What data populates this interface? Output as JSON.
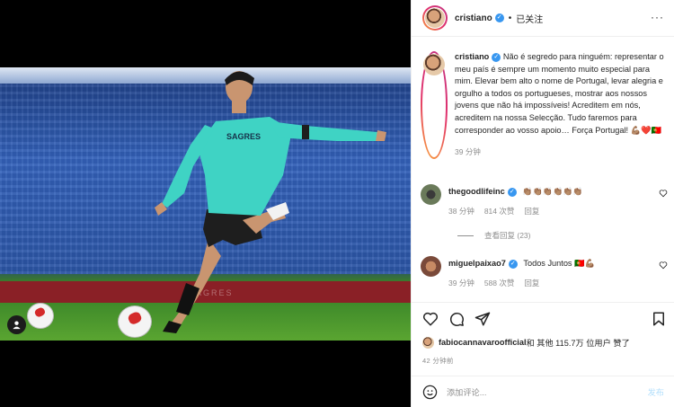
{
  "post": {
    "author": "cristiano",
    "follow_status": "已关注",
    "header_dot": "•",
    "more_glyph": "···",
    "caption": "Não é segredo para ninguém: representar o meu país é sempre um momento muito especial para mim. Elevar bem alto o nome de Portugal, levar alegria e orgulho a todos os portugueses, mostrar aos nossos jovens que não há impossíveis! Acreditem em nós, acreditem na nossa Selecção. Tudo faremos para corresponder ao vosso apoio… Força Portugal! 💪🏽❤️🇵🇹",
    "caption_time": "39 分钟",
    "photo_banner_text": "SAGRES",
    "jersey_text": "SAGRES"
  },
  "comments": [
    {
      "user": "thegoodlifeinc",
      "text": "👏🏽👏🏽👏🏽👏🏽👏🏽👏🏽",
      "time": "38 分钟",
      "likes": "814 次赞",
      "reply": "回复"
    },
    {
      "user": "miguelpaixao7",
      "text": "Todos Juntos 🇵🇹💪🏽",
      "time": "39 分钟",
      "likes": "588 次赞",
      "reply": "回复"
    }
  ],
  "view_replies": "查看回复 (23)",
  "likes_line": {
    "user": "fabiocannavaroofficial",
    "rest": " 和 其他 115.7万 位用户 赞了"
  },
  "posted_ago": "42 分钟前",
  "add_comment": {
    "placeholder": "添加评论...",
    "post_label": "发布"
  },
  "icons": {
    "like": "heart-icon",
    "comment": "comment-icon",
    "share": "paper-plane-icon",
    "save": "bookmark-icon",
    "emoji": "smiley-icon",
    "tag": "user-tag-icon"
  },
  "colors": {
    "verified": "#3897f0",
    "muted": "#8e8e8e",
    "post_button": "#b2dffc"
  }
}
